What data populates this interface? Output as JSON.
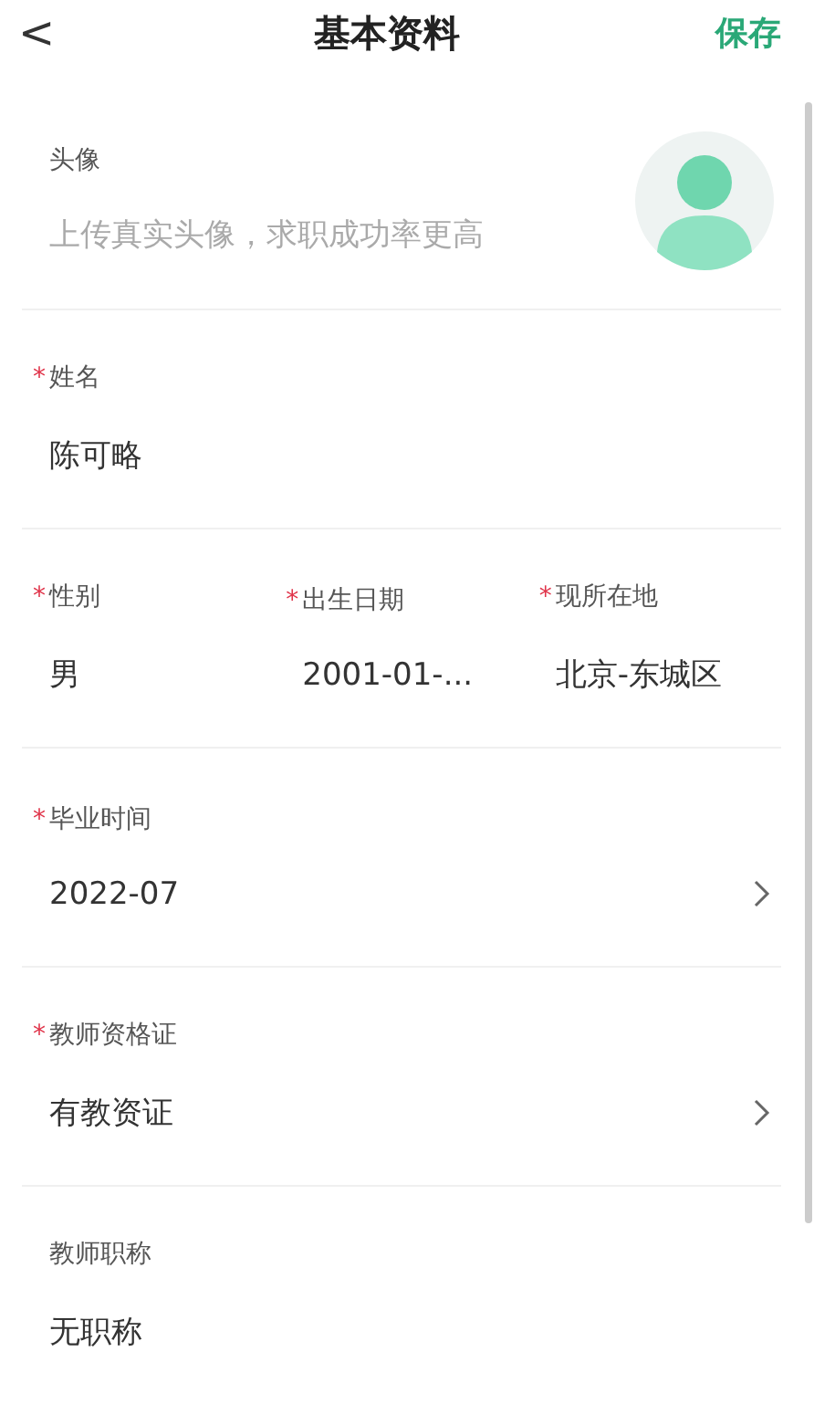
{
  "header": {
    "back": "<",
    "title": "基本资料",
    "action": "保存"
  },
  "avatar": {
    "label": "头像",
    "hint": "上传真实头像，求职成功率更高"
  },
  "sections": [
    {
      "kind": "single",
      "fields": [
        {
          "mark": "*",
          "label": "姓名",
          "value": "陈可略",
          "arrow": false
        }
      ]
    },
    {
      "kind": "triple",
      "fields": [
        {
          "mark": "*",
          "label": "性别",
          "value": "男",
          "arrow": false
        },
        {
          "mark": "*",
          "label": "出生日期",
          "value": "2001-01-...",
          "arrow": false
        },
        {
          "mark": "*",
          "label": "现所在地",
          "value": "北京-东城区",
          "arrow": false
        }
      ]
    },
    {
      "kind": "single",
      "fields": [
        {
          "mark": "*",
          "label": "毕业时间",
          "value": "2022-07",
          "arrow": true
        }
      ]
    },
    {
      "kind": "single",
      "fields": [
        {
          "mark": "*",
          "label": "教师资格证",
          "value": "有教资证",
          "arrow": true
        }
      ]
    },
    {
      "kind": "single",
      "fields": [
        {
          "label": "教师职称",
          "value": "无职称",
          "arrow": false
        }
      ]
    }
  ]
}
